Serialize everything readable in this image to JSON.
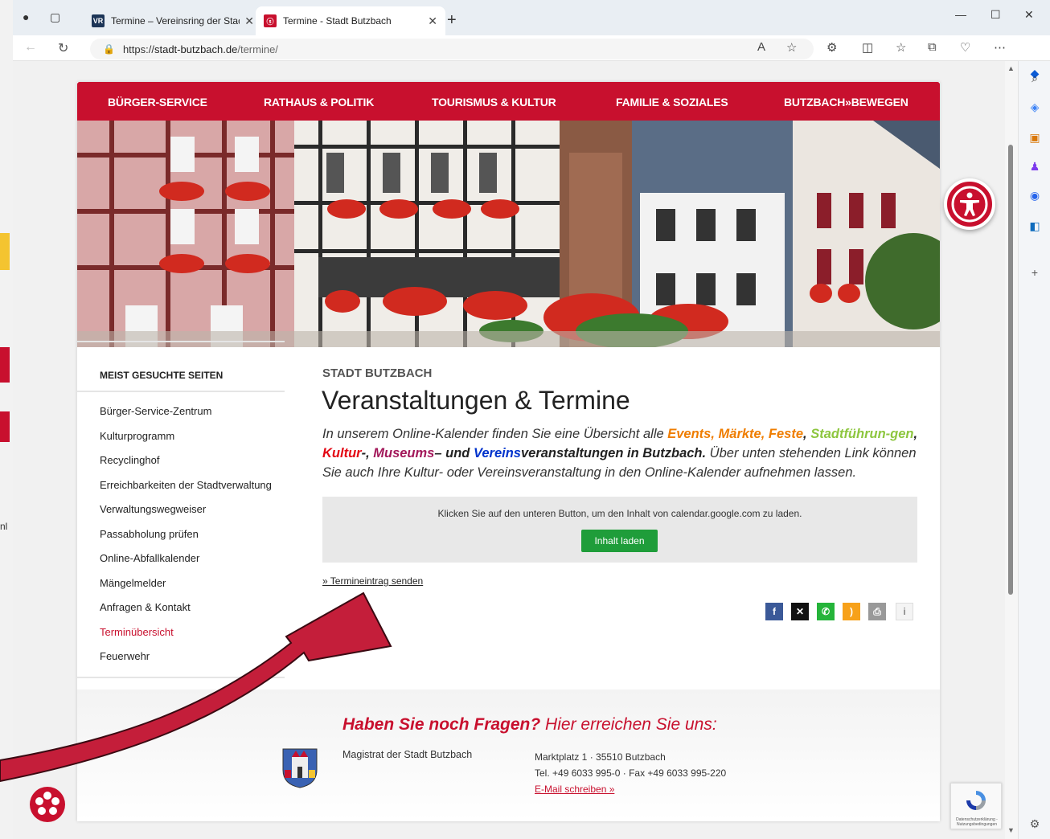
{
  "browser": {
    "tabs": [
      {
        "title": "Termine – Vereinsring der Stadt B",
        "favicon": "VR"
      },
      {
        "title": "Termine - Stadt Butzbach",
        "favicon": "ⓢ"
      }
    ],
    "url_prefix": "https://",
    "url_host": "stadt-butzbach.de",
    "url_path": "/termine/"
  },
  "background_window": {
    "fragment_text": "nl"
  },
  "nav": {
    "items": [
      "BÜRGER-SERVICE",
      "RATHAUS & POLITIK",
      "TOURISMUS & KULTUR",
      "FAMILIE & SOZIALES",
      "BUTZBACH»BEWEGEN"
    ]
  },
  "sidebar": {
    "title": "MEIST GESUCHTE SEITEN",
    "links": [
      "Bürger-Service-Zentrum",
      "Kulturprogramm",
      "Recyclinghof",
      "Erreichbarkeiten der Stadtverwaltung",
      "Verwaltungswegweiser",
      "Passabholung prüfen",
      "Online-Abfallkalender",
      "Mängelmelder",
      "Anfragen & Kontakt",
      "Terminübersicht",
      "Feuerwehr"
    ],
    "active_index": 9
  },
  "content": {
    "kicker": "STADT BUTZBACH",
    "title": "Veranstaltungen & Termine",
    "intro": {
      "p1": "In unserem Online-Kalender finden Sie eine Übersicht alle ",
      "events": "Events",
      "comma1": ", ",
      "maerkte": "Märkte",
      "comma2": ", ",
      "feste": "Feste",
      "comma3": ", ",
      "stadtfuehrungen": "Stadtführun-gen",
      "comma4": ", ",
      "kultur": "Kultur",
      "dash1": "-, ",
      "museums": "Museums",
      "und": "– und ",
      "vereins": "Vereins",
      "veranstaltungen": "veranstaltungen in Butzbach.",
      "p2": " Über unten stehenden Link können Sie auch Ihre Kultur- oder Vereinsveranstaltung in den Online-Kalender aufnehmen lassen."
    },
    "embed_notice": "Klicken Sie auf den unteren Button, um den Inhalt von calendar.google.com zu laden.",
    "load_button": "Inhalt laden",
    "submit_link": "» Termineintrag senden"
  },
  "footer": {
    "title_bold": "Haben Sie noch Fragen?",
    "title_rest": " Hier erreichen Sie uns:",
    "org": "Magistrat der Stadt Butzbach",
    "address": "Marktplatz 1 · 35510 Butzbach",
    "phone": "Tel. +49 6033 995-0 · Fax +49 6033 995-220",
    "email_link": "E-Mail schreiben »"
  },
  "recaptcha": {
    "text": "Datenschutzerklärung - Nutzungsbedingungen"
  },
  "colors": {
    "brand_red": "#c8102e",
    "button_green": "#1f9d3a"
  }
}
